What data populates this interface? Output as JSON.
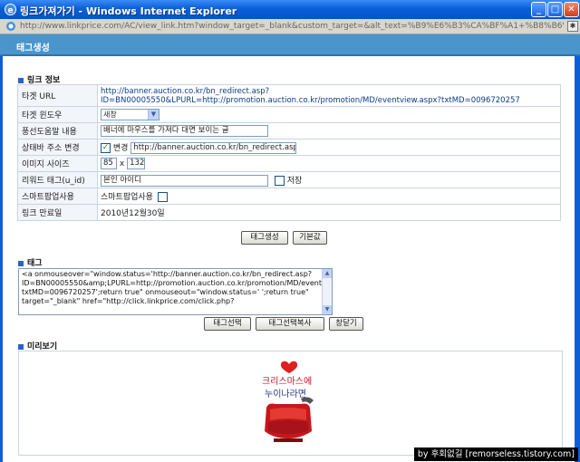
{
  "window": {
    "title": "링크가져가기 - Windows Internet Explorer",
    "minimize": "_",
    "maximize": "□",
    "close": "✕"
  },
  "address": {
    "url": "http://www.linkprice.com/AC/view_link.htm?window_target=_blank&custom_target=&alt_text=%B9%E6%B3%CA%BF%A1+%B8%B6%EC%BD%BA"
  },
  "page": {
    "title": "태그생성"
  },
  "link_info": {
    "section_title": "링크 정보",
    "target_url_label": "타겟 URL",
    "target_url_value": "http://banner.auction.co.kr/bn_redirect.asp?ID=BN00005550&LPURL=http://promotion.auction.co.kr/promotion/MD/eventview.aspx?txtMD=0096720257",
    "window_label": "타겟 윈도우",
    "window_value": "새창",
    "tooltip_label": "풍선도움말 내용",
    "tooltip_value": "배너에 마우스를 가져다 대면 보이는 글",
    "status_label": "상태바 주소 변경",
    "status_check_label": "변경",
    "status_value": "http://banner.auction.co.kr/bn_redirect.asp",
    "size_label": "이미지 사이즈",
    "size_width": "85",
    "size_x": "x",
    "size_height": "132",
    "reward_label": "리워드 태그(u_id)",
    "reward_value": "본인 아이디",
    "reward_save_label": "저장",
    "smart_label": "스마트팝업사용",
    "smart_value_label": "스마트팝업사용",
    "expire_label": "링크 만료일",
    "expire_value": "2010년12월30일"
  },
  "buttons": {
    "create_tag": "태그생성",
    "default": "기본값",
    "select_tag": "태그선택",
    "copy_tag": "태그선택복사",
    "close": "창닫기"
  },
  "tag": {
    "section_title": "태그",
    "code": "<a onmouseover=\"window.status='http://banner.auction.co.kr/bn_redirect.asp?ID=BN00005550&amp;LPURL=http://promotion.auction.co.kr/promotion/MD/eventview.aspx?txtMD=0096720257';return true\" onmouseout=\"window.status=' ';return true\" target=\"_blank\" href=\"http://click.linkprice.com/click.php?"
  },
  "preview": {
    "section_title": "미리보기",
    "banner_text_1": "크리스마스에",
    "banner_text_2": "누이나라면"
  },
  "credit": "by 후회없길 [remorseless.tistory.com]",
  "colors": {
    "titlebar": "#0a5fd8",
    "pagehead": "#4a95cc",
    "link": "#0d3b86",
    "heart": "#e02020"
  }
}
